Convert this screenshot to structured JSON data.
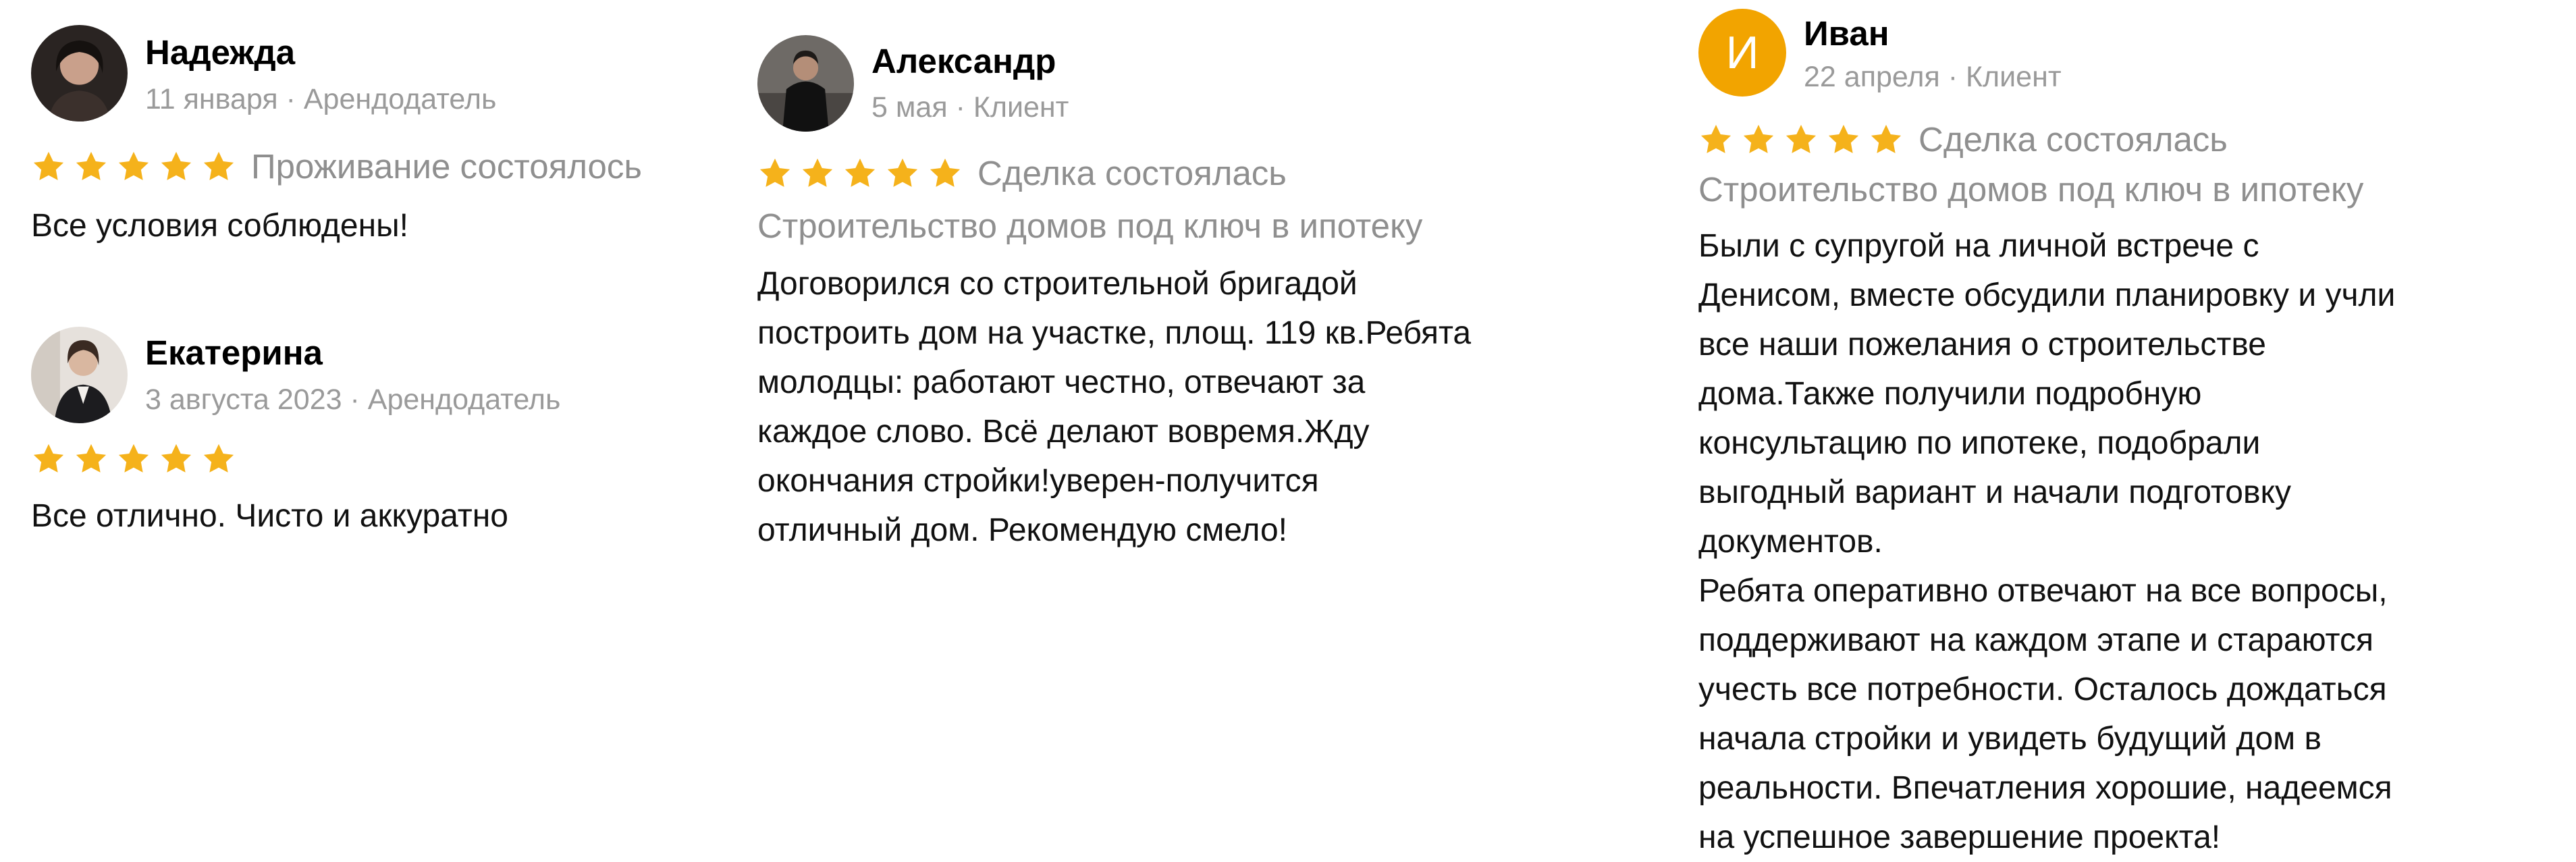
{
  "colors": {
    "star": "#f5b21b",
    "meta": "#9a9a9a",
    "status": "#8f8f8f",
    "avatar_letter_bg": "#f2a400"
  },
  "reviews": [
    {
      "name": "Надежда",
      "date": "11 января",
      "separator": "·",
      "role": "Арендодатель",
      "stars": 5,
      "status": "Проживание состоялось",
      "text": "Все условия соблюдены!"
    },
    {
      "name": "Екатерина",
      "date": "3 августа 2023",
      "separator": "·",
      "role": "Арендодатель",
      "stars": 5,
      "status": "",
      "text": "Все отлично. Чисто и аккуратно"
    },
    {
      "name": "Александр",
      "date": "5 мая",
      "separator": "·",
      "role": "Клиент",
      "stars": 5,
      "status": "Сделка состоялась",
      "subject": "Строительство домов под ключ в ипотеку",
      "text": "Договорился со строительной бригадой\nпостроить дом на участке, площ. 119 кв.Ребята\nмолодцы: работают честно, отвечают за\nкаждое слово. Всё делают вовремя.Жду\nокончания стройки!уверен-получится\nотличный дом. Рекомендую смело!"
    },
    {
      "name": "Иван",
      "avatar_letter": "И",
      "date": "22 апреля",
      "separator": "·",
      "role": "Клиент",
      "stars": 5,
      "status": "Сделка состоялась",
      "subject": "Строительство домов под ключ в ипотеку",
      "text": "Были с супругой на личной встрече с\nДенисом, вместе обсудили планировку и учли\nвсе наши пожелания о строительстве\nдома.Также получили подробную\nконсультацию по ипотеке, подобрали\nвыгодный вариант и начали подготовку\nдокументов.\nРебята оперативно отвечают на все вопросы,\nподдерживают на каждом этапе и стараются\nучесть все потребности. Осталось дождаться\nначала стройки и увидеть будущий дом в\nреальности. Впечатления хорошие, надеемся\nна успешное завершение проекта!"
    }
  ]
}
